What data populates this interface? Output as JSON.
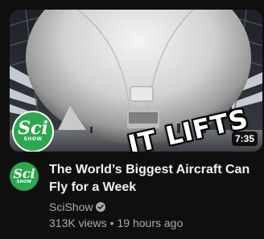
{
  "video": {
    "overlay_text": "IT LIFTS",
    "thumb_logo_big": "Sci",
    "thumb_logo_small": "SHOW",
    "duration": "7:35",
    "title": "The World’s Biggest Aircraft Can Fly for a Week",
    "channel": "SciShow",
    "verified_icon": "verified-check-icon",
    "views": "313K views",
    "separator": "•",
    "age": "19 hours ago"
  },
  "avatar": {
    "big": "Sci",
    "small": "SHOW"
  },
  "colors": {
    "background": "#0f0f0f",
    "title": "#f1f1f1",
    "secondary": "#aaaaaa",
    "brand_green": "#2ea84f"
  }
}
